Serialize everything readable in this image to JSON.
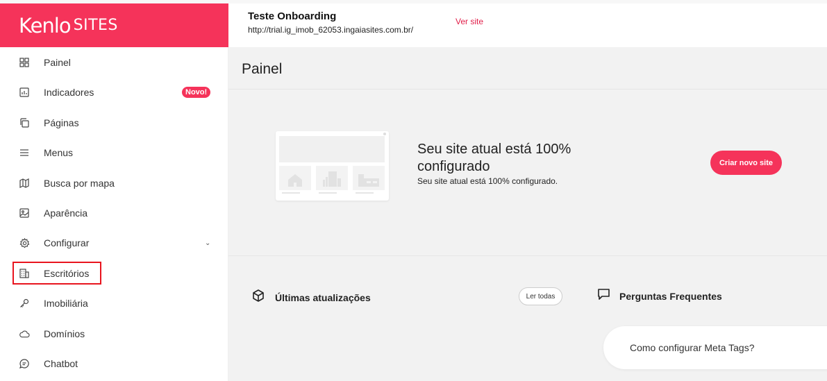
{
  "brand": {
    "logo_main": "Kenlo",
    "logo_sub": "SITES",
    "color": "#f5335a"
  },
  "header": {
    "site_name": "Teste Onboarding",
    "site_url": "http://trial.ig_imob_62053.ingaiasites.com.br/",
    "view_link": "Ver site"
  },
  "sidebar": {
    "items": [
      {
        "label": "Painel",
        "icon": "grid-icon"
      },
      {
        "label": "Indicadores",
        "icon": "chart-icon",
        "badge": "Novo!"
      },
      {
        "label": "Páginas",
        "icon": "pages-icon"
      },
      {
        "label": "Menus",
        "icon": "menu-icon"
      },
      {
        "label": "Busca por mapa",
        "icon": "map-icon"
      },
      {
        "label": "Aparência",
        "icon": "image-icon"
      },
      {
        "label": "Configurar",
        "icon": "gear-icon",
        "expandable": true
      },
      {
        "label": "Escritórios",
        "icon": "building-icon",
        "highlighted": true
      },
      {
        "label": "Imobiliária",
        "icon": "key-icon"
      },
      {
        "label": "Domínios",
        "icon": "cloud-icon"
      },
      {
        "label": "Chatbot",
        "icon": "chat-icon"
      }
    ]
  },
  "main": {
    "title": "Painel",
    "status_title": "Seu site atual está 100% configurado",
    "status_subtitle": "Seu site atual está 100% configurado.",
    "create_button": "Criar novo site",
    "updates_title": "Últimas atualizações",
    "read_all_button": "Ler todas",
    "faq_title": "Perguntas Frequentes",
    "faq_items": [
      "Como configurar Meta Tags?"
    ]
  }
}
